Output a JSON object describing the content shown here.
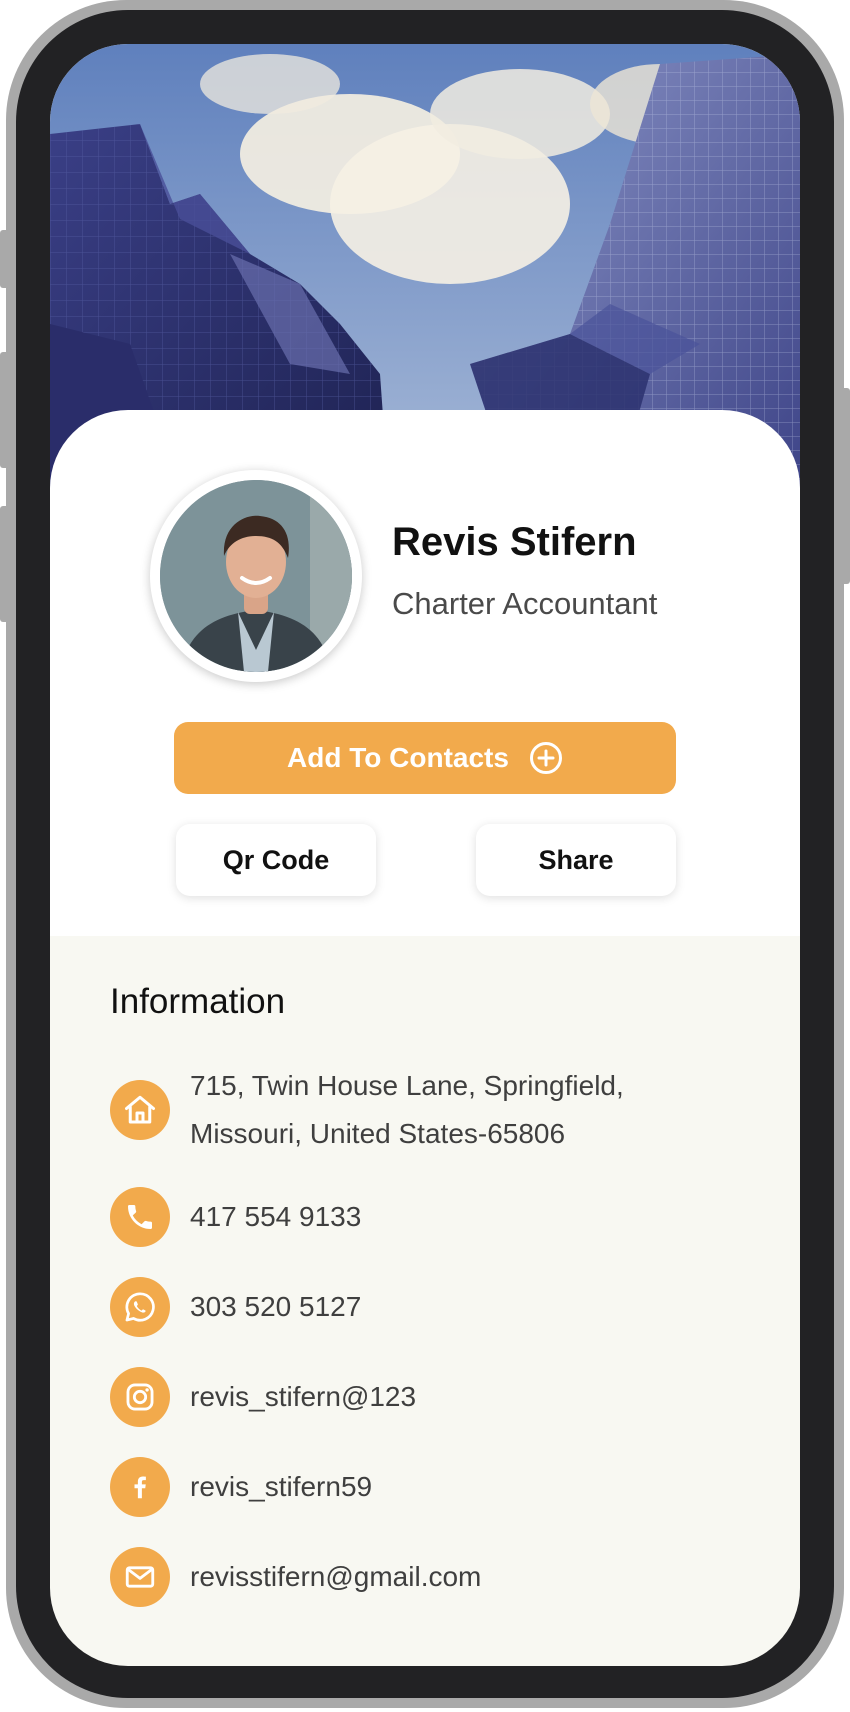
{
  "profile": {
    "name": "Revis Stifern",
    "title": "Charter Accountant"
  },
  "actions": {
    "add_contacts_label": "Add To Contacts",
    "qr_code_label": "Qr Code",
    "share_label": "Share"
  },
  "information": {
    "heading": "Information",
    "address_line1": "715, Twin House Lane, Springfield,",
    "address_line2": "Missouri, United States-65806",
    "phone": "417 554 9133",
    "whatsapp": "303 520 5127",
    "instagram": "revis_stifern@123",
    "facebook": "revis_stifern59",
    "email": "revisstifern@gmail.com"
  },
  "colors": {
    "accent": "#f2aa4c",
    "info_background": "#f8f8f2",
    "phone_frame": "#222224"
  },
  "icons": [
    "home-icon",
    "phone-icon",
    "whatsapp-icon",
    "instagram-icon",
    "facebook-icon",
    "mail-icon",
    "plus-circle-icon"
  ]
}
